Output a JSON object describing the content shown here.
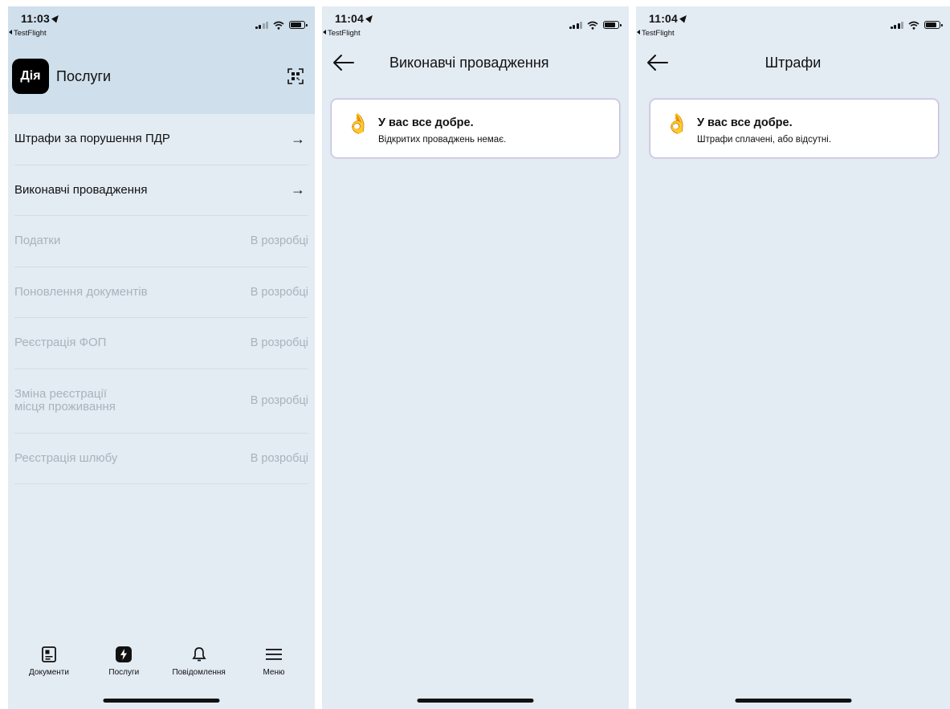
{
  "screens": [
    {
      "status": {
        "time": "11:03",
        "back_app": "TestFlight"
      },
      "header": {
        "logo_text": "Дія",
        "title": "Послуги"
      },
      "services": [
        {
          "name": "Штрафи за порушення ПДР",
          "status": "",
          "enabled": true
        },
        {
          "name": "Виконавчі провадження",
          "status": "",
          "enabled": true
        },
        {
          "name": "Податки",
          "status": "В розробці",
          "enabled": false
        },
        {
          "name": "Поновлення документів",
          "status": "В розробці",
          "enabled": false
        },
        {
          "name": "Реєстрація ФОП",
          "status": "В розробці",
          "enabled": false
        },
        {
          "name_line1": "Зміна реєстрації",
          "name_line2": "місця проживання",
          "status": "В розробці",
          "enabled": false
        },
        {
          "name": "Реєстрація шлюбу",
          "status": "В розробці",
          "enabled": false
        }
      ],
      "tabbar": [
        {
          "label": "Документи",
          "icon": "document-icon"
        },
        {
          "label": "Послуги",
          "icon": "lightning-icon"
        },
        {
          "label": "Повідомлення",
          "icon": "bell-icon"
        },
        {
          "label": "Меню",
          "icon": "menu-icon"
        }
      ]
    },
    {
      "status": {
        "time": "11:04",
        "back_app": "TestFlight"
      },
      "title": "Виконавчі провадження",
      "card": {
        "emoji": "👌",
        "title": "У вас все добре.",
        "subtitle": "Відкритих проваджень немає."
      }
    },
    {
      "status": {
        "time": "11:04",
        "back_app": "TestFlight"
      },
      "title": "Штрафи",
      "card": {
        "emoji": "👌",
        "title": "У вас все добре.",
        "subtitle": "Штрафи сплачені, або відсутні."
      }
    }
  ],
  "colors": {
    "background": "#e3ebf3",
    "header": "#cfdfec",
    "disabled_text": "#a9b3bc",
    "card_border": "#b7c4e8"
  }
}
